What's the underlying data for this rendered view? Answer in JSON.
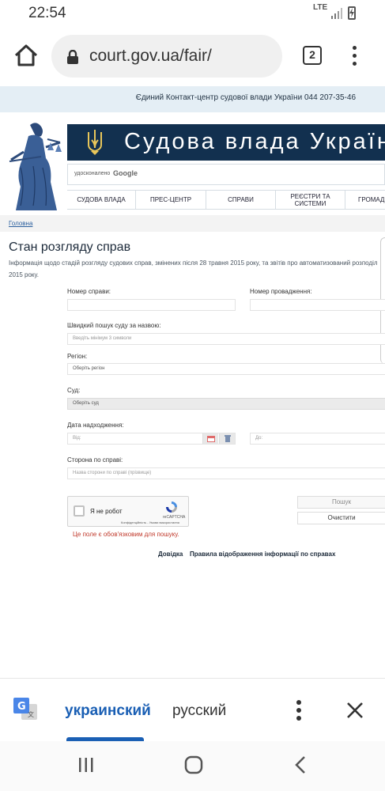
{
  "status_bar": {
    "time": "22:54",
    "network": "LTE"
  },
  "browser": {
    "url": "court.gov.ua/fair/",
    "tab_count": "2"
  },
  "site": {
    "contact_line": "Єдиний Контакт-центр судової влади України 044 207-35-46",
    "banner_title": "Судова влада України",
    "search_label": "удосконалено",
    "search_brand": "Google",
    "nav": [
      "СУДОВА ВЛАДА",
      "ПРЕС-ЦЕНТР",
      "СПРАВИ",
      "РЕЄСТРИ ТА\nСИСТЕМИ",
      "ГРОМАД"
    ],
    "breadcrumb": "Головна"
  },
  "page": {
    "title": "Стан розгляду справ",
    "intro_line1": "Інформація щодо стадій розгляду судових справ, змінених після 28 травня 2015 року, та звітів про автоматизований розподіл",
    "intro_line2": "2015 року."
  },
  "form": {
    "case_number_label": "Номер справи:",
    "proceeding_number_label": "Номер провадження:",
    "quick_search_label": "Швидкий пошук суду за назвою:",
    "quick_search_placeholder": "Введіть мінімум 3 символи",
    "region_label": "Регіон:",
    "region_value": "Оберіть регіон",
    "court_label": "Суд:",
    "court_value": "Оберіть суд",
    "date_label": "Дата надходження:",
    "date_from_placeholder": "Від:",
    "date_to_placeholder": "До:",
    "party_label": "Сторона по справі:",
    "party_placeholder": "Назва сторони по справі (прізвище)",
    "recaptcha_text": "Я не робот",
    "recaptcha_brand": "reCAPTCHA",
    "recaptcha_links": "Конфіденційність - Умови використання",
    "search_button": "Пошук",
    "clear_button": "Очистити",
    "error_text": "Це поле є обов'язковим для пошуку.",
    "help_link": "Довідка",
    "rules_link": "Правила відображення інформації по справах"
  },
  "translate_bar": {
    "lang_active": "украинский",
    "lang_other": "русский"
  },
  "colors": {
    "banner": "#12304f",
    "link": "#2a5f9e",
    "error": "#c0392b",
    "translate_accent": "#1a5fb4"
  }
}
